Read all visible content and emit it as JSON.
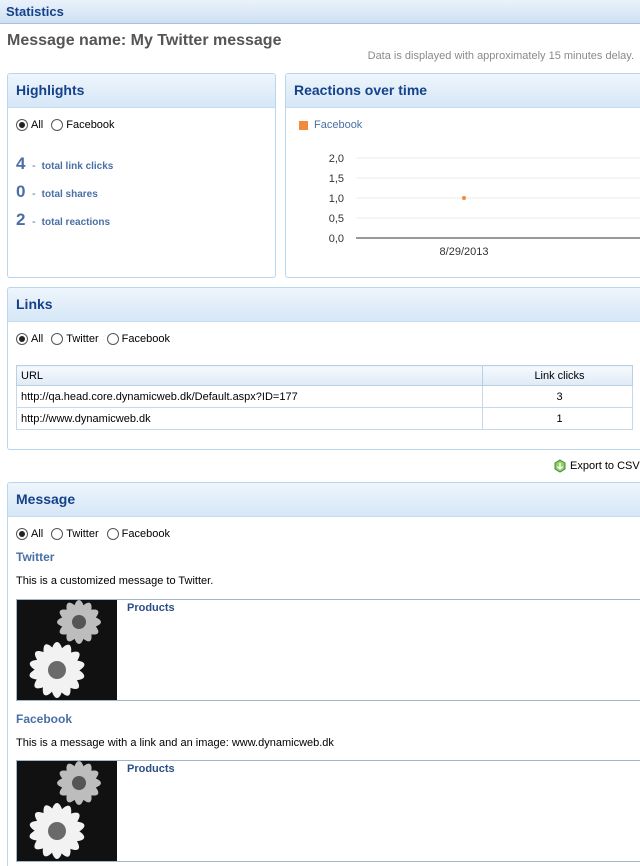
{
  "header": {
    "title": "Statistics"
  },
  "message_name": "Message name: My Twitter message",
  "delay_note": "Data is displayed with approximately 15 minutes delay.",
  "highlights": {
    "title": "Highlights",
    "filters": [
      "All",
      "Facebook"
    ],
    "selected": "All",
    "rows": [
      {
        "value": "4",
        "label": "total link clicks"
      },
      {
        "value": "0",
        "label": "total shares"
      },
      {
        "value": "2",
        "label": "total reactions"
      }
    ]
  },
  "reactions": {
    "title": "Reactions over time",
    "legend": "Facebook",
    "legend_color": "#f08a3c"
  },
  "chart_data": {
    "type": "scatter",
    "title": "",
    "xlabel": "",
    "ylabel": "",
    "x": [
      "8/29/2013"
    ],
    "series": [
      {
        "name": "Facebook",
        "values": [
          1.0
        ]
      }
    ],
    "ylim": [
      0,
      2
    ],
    "yticks": [
      "0,0",
      "0,5",
      "1,0",
      "1,5",
      "2,0"
    ],
    "grid": true
  },
  "links": {
    "title": "Links",
    "filters": [
      "All",
      "Twitter",
      "Facebook"
    ],
    "selected": "All",
    "columns": [
      "URL",
      "Link clicks"
    ],
    "rows": [
      {
        "url": "http://qa.head.core.dynamicweb.dk/Default.aspx?ID=177",
        "clicks": "3"
      },
      {
        "url": "http://www.dynamicweb.dk",
        "clicks": "1"
      }
    ]
  },
  "export_label": "Export to CSV",
  "message": {
    "title": "Message",
    "filters": [
      "All",
      "Twitter",
      "Facebook"
    ],
    "selected": "All",
    "twitter": {
      "heading": "Twitter",
      "text": "This is a customized message to Twitter.",
      "card_title": "Products"
    },
    "facebook": {
      "heading": "Facebook",
      "text": "This is a message with a link and an image: www.dynamicweb.dk",
      "card_title": "Products"
    }
  }
}
